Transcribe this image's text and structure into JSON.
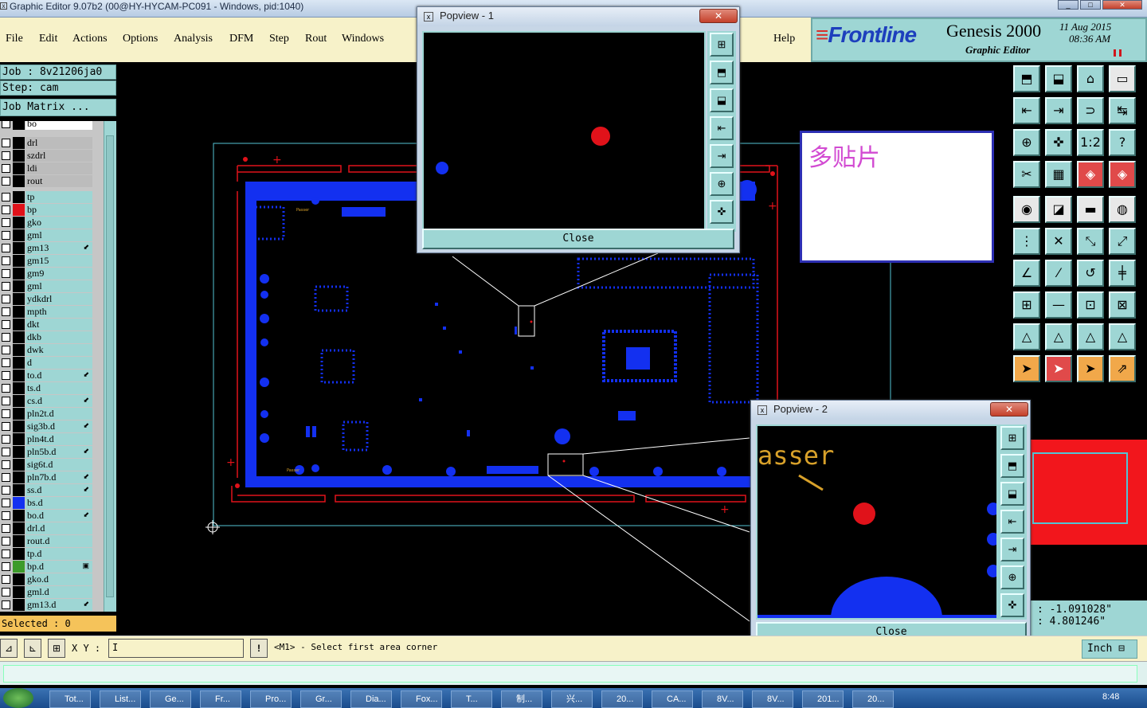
{
  "window": {
    "title": "Graphic Editor 9.07b2 (00@HY-HYCAM-PC091 - Windows, pid:1040)",
    "close_glyph": "x",
    "min_glyph": "_",
    "max_glyph": "□",
    "close_x": "✕"
  },
  "menu": {
    "items": [
      "File",
      "Edit",
      "Actions",
      "Options",
      "Analysis",
      "DFM",
      "Step",
      "Rout",
      "Windows"
    ],
    "help": "Help"
  },
  "brand": {
    "logo": "Frontline",
    "product": "Genesis 2000",
    "subtitle": "Graphic Editor",
    "date": "11 Aug 2015",
    "time": "08:36 AM",
    "logo_color": "#1d3fbd",
    "accent_color": "#d0151c"
  },
  "job": {
    "job_label": "Job : 8v21206ja0",
    "step_label": "Step: cam",
    "matrix_label": "Job Matrix ..."
  },
  "layers": [
    {
      "name": "bo",
      "swatch": "#000",
      "style": "white",
      "mark": ""
    },
    {
      "name": "drl",
      "swatch": "#000",
      "style": "gray",
      "mark": ""
    },
    {
      "name": "szdrl",
      "swatch": "#000",
      "style": "gray",
      "mark": ""
    },
    {
      "name": "ldi",
      "swatch": "#000",
      "style": "gray",
      "mark": ""
    },
    {
      "name": "rout",
      "swatch": "#000",
      "style": "gray",
      "mark": ""
    },
    {
      "name": "tp",
      "swatch": "#000",
      "style": "cyan",
      "mark": ""
    },
    {
      "name": "bp",
      "swatch": "#e0121a",
      "style": "cyan",
      "mark": ""
    },
    {
      "name": "gko",
      "swatch": "#000",
      "style": "cyan",
      "mark": ""
    },
    {
      "name": "gml",
      "swatch": "#000",
      "style": "cyan",
      "mark": ""
    },
    {
      "name": "gm13",
      "swatch": "#000",
      "style": "cyan",
      "mark": "⬋"
    },
    {
      "name": "gm15",
      "swatch": "#000",
      "style": "cyan",
      "mark": ""
    },
    {
      "name": "gm9",
      "swatch": "#000",
      "style": "cyan",
      "mark": ""
    },
    {
      "name": "gml",
      "swatch": "#000",
      "style": "cyan",
      "mark": ""
    },
    {
      "name": "ydkdrl",
      "swatch": "#000",
      "style": "cyan",
      "mark": ""
    },
    {
      "name": "mpth",
      "swatch": "#000",
      "style": "cyan",
      "mark": ""
    },
    {
      "name": "dkt",
      "swatch": "#000",
      "style": "cyan",
      "mark": ""
    },
    {
      "name": "dkb",
      "swatch": "#000",
      "style": "cyan",
      "mark": ""
    },
    {
      "name": "dwk",
      "swatch": "#000",
      "style": "cyan",
      "mark": ""
    },
    {
      "name": "d",
      "swatch": "#000",
      "style": "cyan",
      "mark": ""
    },
    {
      "name": "to.d",
      "swatch": "#000",
      "style": "cyan",
      "mark": "⬋"
    },
    {
      "name": "ts.d",
      "swatch": "#000",
      "style": "cyan",
      "mark": ""
    },
    {
      "name": "cs.d",
      "swatch": "#000",
      "style": "cyan",
      "mark": "⬋"
    },
    {
      "name": "pln2t.d",
      "swatch": "#000",
      "style": "cyan",
      "mark": ""
    },
    {
      "name": "sig3b.d",
      "swatch": "#000",
      "style": "cyan",
      "mark": "⬋"
    },
    {
      "name": "pln4t.d",
      "swatch": "#000",
      "style": "cyan",
      "mark": ""
    },
    {
      "name": "pln5b.d",
      "swatch": "#000",
      "style": "cyan",
      "mark": "⬋"
    },
    {
      "name": "sig6t.d",
      "swatch": "#000",
      "style": "cyan",
      "mark": ""
    },
    {
      "name": "pln7b.d",
      "swatch": "#000",
      "style": "cyan",
      "mark": "⬋"
    },
    {
      "name": "ss.d",
      "swatch": "#000",
      "style": "cyan",
      "mark": "⬋"
    },
    {
      "name": "bs.d",
      "swatch": "#1330f0",
      "style": "cyan",
      "mark": ""
    },
    {
      "name": "bo.d",
      "swatch": "#000",
      "style": "cyan",
      "mark": "⬋"
    },
    {
      "name": "drl.d",
      "swatch": "#000",
      "style": "cyan",
      "mark": ""
    },
    {
      "name": "rout.d",
      "swatch": "#000",
      "style": "cyan",
      "mark": ""
    },
    {
      "name": "tp.d",
      "swatch": "#000",
      "style": "cyan",
      "mark": ""
    },
    {
      "name": "bp.d",
      "swatch": "#3d9b2a",
      "style": "cyan",
      "mark": "▣"
    },
    {
      "name": "gko.d",
      "swatch": "#000",
      "style": "cyan",
      "mark": ""
    },
    {
      "name": "gml.d",
      "swatch": "#000",
      "style": "cyan",
      "mark": ""
    },
    {
      "name": "gm13.d",
      "swatch": "#000",
      "style": "cyan",
      "mark": "⬋"
    }
  ],
  "selected_label": "Selected : 0",
  "status": {
    "xy_label": "X Y :",
    "xy_value": "I",
    "message": "<M1> - Select first area corner",
    "units": "Inch ⊟"
  },
  "coords": {
    "x": ": -1.091028\"",
    "y": ":  4.801246\""
  },
  "note_text": "多贴片",
  "popup1": {
    "title": "Popview - 1",
    "close": "Close"
  },
  "popup2": {
    "title": "Popview - 2",
    "close": "Close",
    "text": "asser"
  },
  "board": {
    "label": "Passer"
  },
  "taskbar": {
    "items": [
      "Tot...",
      "List...",
      "Ge...",
      "Fr...",
      "Pro...",
      "Gr...",
      "Dia...",
      "Fox...",
      "T...",
      "制...",
      "兴...",
      "20...",
      "CA...",
      "8V...",
      "8V...",
      "201...",
      "20..."
    ],
    "clock": "8:48"
  },
  "tools": [
    "⬒",
    "⬓",
    "⌂",
    "▭",
    "⇤",
    "⇥",
    "⊃",
    "↹",
    "⊕",
    "✜",
    "1:2",
    "?",
    "✂",
    "▦",
    "◈",
    "◈",
    "◉",
    "◪",
    "▬",
    "◍",
    "⋮",
    "✕",
    "⤡",
    "⤢",
    "∠",
    "⁄",
    "↺",
    "╪",
    "⊞",
    "—",
    "⊡",
    "⊠",
    "△",
    "△",
    "△",
    "△",
    "➤",
    "➤",
    "➤",
    "⇗"
  ]
}
